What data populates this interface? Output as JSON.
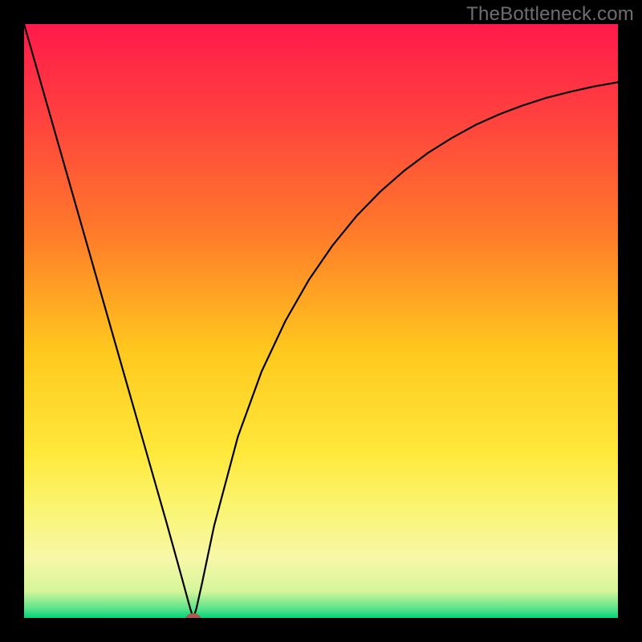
{
  "watermark": "TheBottleneck.com",
  "chart_data": {
    "type": "line",
    "title": "",
    "xlabel": "",
    "ylabel": "",
    "xlim": [
      0,
      1
    ],
    "ylim": [
      0,
      1
    ],
    "background_gradient_stops": [
      {
        "offset": 0.0,
        "color": "#ff1a4b"
      },
      {
        "offset": 0.15,
        "color": "#ff3f3f"
      },
      {
        "offset": 0.35,
        "color": "#ff7a2a"
      },
      {
        "offset": 0.55,
        "color": "#ffc81e"
      },
      {
        "offset": 0.72,
        "color": "#ffe83a"
      },
      {
        "offset": 0.82,
        "color": "#faf574"
      },
      {
        "offset": 0.9,
        "color": "#f7f7a8"
      },
      {
        "offset": 0.955,
        "color": "#d6f59a"
      },
      {
        "offset": 0.985,
        "color": "#58e38a"
      },
      {
        "offset": 1.0,
        "color": "#00d47a"
      }
    ],
    "curve": {
      "comment": "V-shaped curve; minimum near x≈0.285; left branch steep linear, right branch concave rising.",
      "x": [
        0.0,
        0.04,
        0.08,
        0.12,
        0.16,
        0.2,
        0.24,
        0.265,
        0.28,
        0.285,
        0.29,
        0.3,
        0.32,
        0.36,
        0.4,
        0.44,
        0.48,
        0.52,
        0.56,
        0.6,
        0.64,
        0.68,
        0.72,
        0.76,
        0.8,
        0.84,
        0.88,
        0.92,
        0.96,
        1.0
      ],
      "y": [
        1.0,
        0.86,
        0.72,
        0.58,
        0.44,
        0.3,
        0.16,
        0.07,
        0.015,
        0.0,
        0.015,
        0.06,
        0.155,
        0.305,
        0.415,
        0.5,
        0.57,
        0.628,
        0.677,
        0.718,
        0.753,
        0.783,
        0.808,
        0.83,
        0.848,
        0.863,
        0.876,
        0.886,
        0.895,
        0.902
      ]
    },
    "marker": {
      "x": 0.285,
      "y": 0.0,
      "rx": 0.012,
      "ry": 0.008,
      "color": "#b05a4a"
    }
  }
}
